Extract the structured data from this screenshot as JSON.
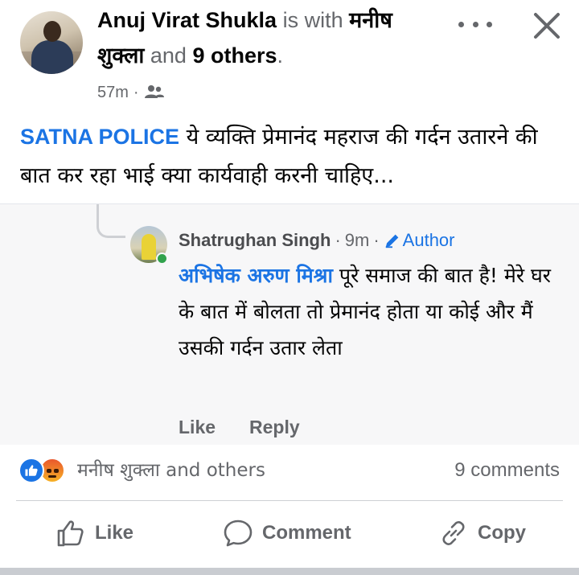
{
  "post": {
    "author_name": "Anuj Virat Shukla",
    "with_text": "is with",
    "tagged_name": "मनीष शुक्ला",
    "and_text": "and",
    "others_text": "9 others",
    "period": ".",
    "timestamp": "57m",
    "audience_icon": "friends-icon",
    "tag_text": "SATNA POLICE",
    "body_text": " ये व्यक्ति प्रेमानंद महराज की गर्दन उतारने की बात कर रहा भाई क्या कार्यवाही करनी चाहिए..."
  },
  "comment": {
    "author_name": "Shatrughan Singh",
    "time": "9m",
    "badge": "Author",
    "mention": "अभिषेक अरुण मिश्रा",
    "text": " पूरे समाज की बात है! मेरे घर के बात में बोलता तो प्रेमानंद होता या कोई और मैं उसकी गर्दन उतार लेता",
    "like_label": "Like",
    "reply_label": "Reply"
  },
  "reactions": {
    "names": "मनीष शुक्ला and others",
    "comments_count": "9 comments",
    "icons": [
      "like-reaction-icon",
      "angry-reaction-icon"
    ]
  },
  "actions": {
    "like_label": "Like",
    "comment_label": "Comment",
    "copy_label": "Copy"
  },
  "colors": {
    "link_blue": "#1b74e4",
    "muted_gray": "#65676b",
    "online_green": "#31a24c"
  }
}
